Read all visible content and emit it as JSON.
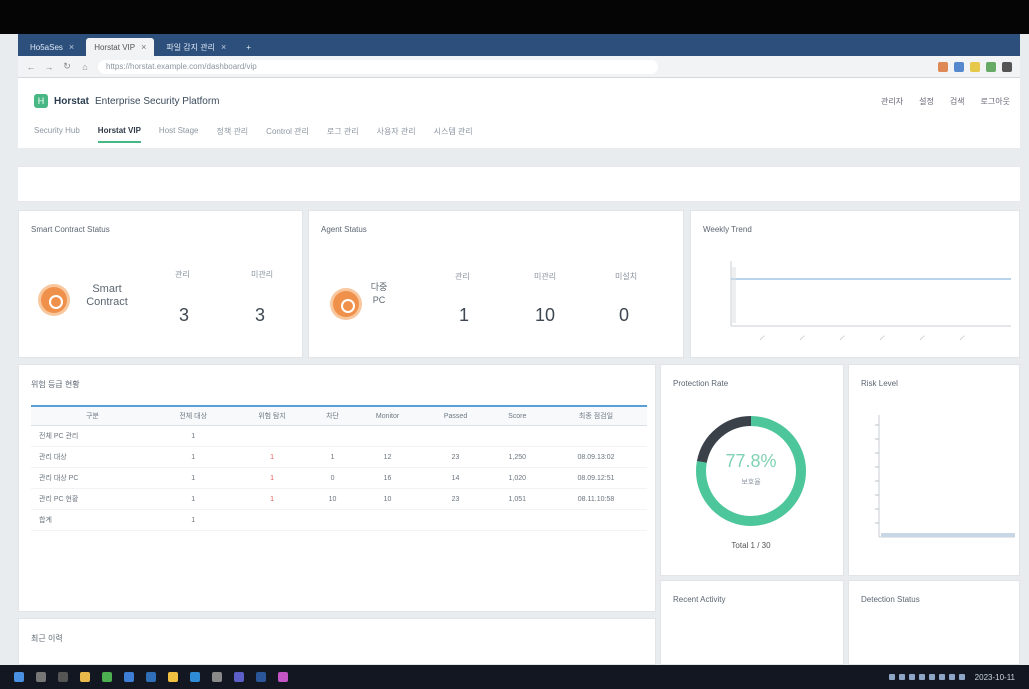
{
  "browser": {
    "tabs": [
      {
        "label": "Ho5aSes",
        "active": false
      },
      {
        "label": "Horstat VIP",
        "active": true
      },
      {
        "label": "파일 감지 관리",
        "active": false
      }
    ],
    "url": "https://horstat.example.com/dashboard/vip"
  },
  "app": {
    "logo_letter": "H",
    "brand_name": "Horstat",
    "brand_sub": "Enterprise Security Platform",
    "header_right": [
      "관리자",
      "설정",
      "검색",
      "로그아웃"
    ],
    "menu": [
      {
        "label": "Security Hub",
        "active": false
      },
      {
        "label": "Horstat VIP",
        "active": true
      },
      {
        "label": "Host Stage",
        "active": false
      },
      {
        "label": "정책 관리",
        "active": false
      },
      {
        "label": "Control 관리",
        "active": false
      },
      {
        "label": "로그 관리",
        "active": false
      },
      {
        "label": "사용자 관리",
        "active": false
      },
      {
        "label": "시스템 관리",
        "active": false
      }
    ]
  },
  "cards": {
    "smart": {
      "title": "Smart Contract Status",
      "name_line1": "Smart",
      "name_line2": "Contract",
      "col1_label": "관리",
      "col2_label": "미관리",
      "col1_value": "3",
      "col2_value": "3"
    },
    "agent": {
      "title": "Agent Status",
      "name_line1": "다중",
      "name_line2": "PC",
      "col1_label": "관리",
      "col2_label": "미관리",
      "col3_label": "미설치",
      "col1_value": "1",
      "col2_value": "10",
      "col3_value": "0"
    },
    "trend": {
      "title": "Weekly Trend"
    },
    "risk_table": {
      "title": "위험 등급 현황",
      "headers": [
        "구분",
        "전체 대상",
        "위험 탐지",
        "차단",
        "Monitor",
        "Passed",
        "Score",
        "최종 점검일"
      ],
      "rows": [
        [
          "전체 PC 관리",
          "1",
          "",
          "",
          "",
          "",
          "",
          ""
        ],
        [
          "관리 대상",
          "1",
          "1",
          "1",
          "12",
          "23",
          "1,250",
          "08.09.13:02"
        ],
        [
          "관리 대상 PC",
          "1",
          "1",
          "0",
          "16",
          "14",
          "1,020",
          "08.09.12:51"
        ],
        [
          "관리 PC 현황",
          "1",
          "1",
          "10",
          "10",
          "23",
          "1,051",
          "08.11.10:58"
        ],
        [
          "합계",
          "1",
          "",
          "",
          "",
          "",
          "",
          ""
        ]
      ]
    },
    "donut": {
      "title": "Protection Rate",
      "percent": "77.8%",
      "percent_value": 77.8,
      "sub": "보호율",
      "total": "Total 1 / 30"
    },
    "bars": {
      "title": "Risk Level"
    },
    "activity": {
      "title": "Recent Activity"
    },
    "detection": {
      "title": "Detection Status"
    },
    "history": {
      "title": "최근 이력"
    }
  },
  "colors": {
    "accent": "#48b784",
    "header": "#2c4f7c",
    "orange": "#f0914b",
    "donut_dark": "#3b4149"
  },
  "taskbar_icons": [
    "start-icon",
    "search-icon",
    "task-view-icon",
    "explorer-icon",
    "chrome-icon",
    "mail-icon",
    "calendar-icon",
    "store-icon",
    "edge-icon",
    "settings-icon",
    "teams-icon",
    "word-icon",
    "excel-icon"
  ],
  "clock": "2023-10-11"
}
